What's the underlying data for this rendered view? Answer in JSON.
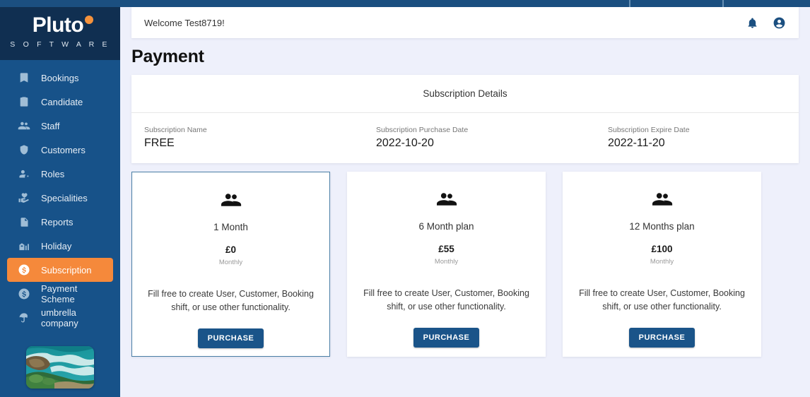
{
  "brand": {
    "name": "Pluto",
    "subtitle": "S O F T W A R E",
    "dot_color": "#f5923c",
    "sidebar_color": "#175289",
    "logo_bg": "#102f51"
  },
  "sidebar": {
    "items": [
      {
        "label": "Bookings",
        "icon": "bookmark-icon",
        "active": false
      },
      {
        "label": "Candidate",
        "icon": "clipboard-icon",
        "active": false
      },
      {
        "label": "Staff",
        "icon": "people-icon",
        "active": false
      },
      {
        "label": "Customers",
        "icon": "shield-icon",
        "active": false
      },
      {
        "label": "Roles",
        "icon": "person-gear-icon",
        "active": false
      },
      {
        "label": "Specialities",
        "icon": "hand-heart-icon",
        "active": false
      },
      {
        "label": "Reports",
        "icon": "document-icon",
        "active": false
      },
      {
        "label": "Holiday",
        "icon": "building-icon",
        "active": false
      },
      {
        "label": "Subscription",
        "icon": "dollar-icon",
        "active": true
      },
      {
        "label": "Payment Scheme",
        "icon": "dollar-icon",
        "active": false
      },
      {
        "label": "umbrella company",
        "icon": "umbrella-icon",
        "active": false
      }
    ],
    "active_color": "#f5893b",
    "thumbnail_name": "coastal-ocean-photo"
  },
  "header": {
    "welcome": "Welcome Test8719!",
    "notification_icon": "bell-icon",
    "account_icon": "account-circle-icon"
  },
  "page": {
    "title": "Payment"
  },
  "subscription_details": {
    "heading": "Subscription Details",
    "fields": [
      {
        "label": "Subscription Name",
        "value": "FREE"
      },
      {
        "label": "Subscription Purchase Date",
        "value": "2022-10-20"
      },
      {
        "label": "Subscription Expire Date",
        "value": "2022-11-20"
      }
    ]
  },
  "plans": [
    {
      "icon": "people-group-icon",
      "name": "1 Month",
      "price": "£0",
      "period": "Monthly",
      "description": "Fill free to create User, Customer, Booking shift, or use other functionality.",
      "button_label": "PURCHASE",
      "selected": true
    },
    {
      "icon": "people-group-icon",
      "name": "6 Month plan",
      "price": "£55",
      "period": "Monthly",
      "description": "Fill free to create User, Customer, Booking shift, or use other functionality.",
      "button_label": "PURCHASE",
      "selected": false
    },
    {
      "icon": "people-group-icon",
      "name": "12 Months plan",
      "price": "£100",
      "period": "Monthly",
      "description": "Fill free to create User, Customer, Booking shift, or use other functionality.",
      "button_label": "PURCHASE",
      "selected": false
    }
  ],
  "colors": {
    "page_background": "#eef0fb",
    "primary": "#1b4f80",
    "accent": "#f5893b",
    "button": "#1a5489",
    "selected_border": "#4b7fa6"
  }
}
